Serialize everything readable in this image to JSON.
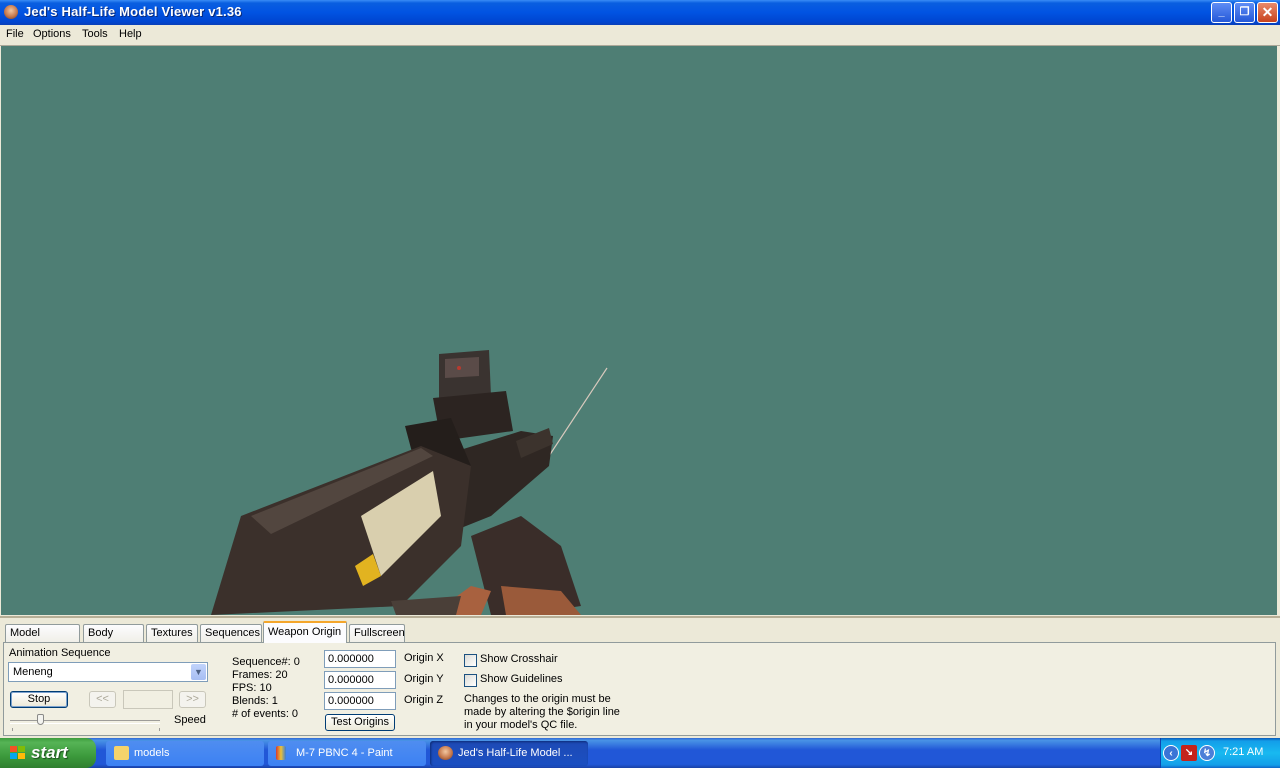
{
  "window": {
    "title": "Jed's Half-Life Model Viewer v1.36",
    "controls": {
      "minimize": "_",
      "restore": "❐",
      "close": "✕"
    }
  },
  "menu": [
    "File",
    "Options",
    "Tools",
    "Help"
  ],
  "viewport": {
    "background_color": "#4e7e74",
    "content": "P90-style SMG model with holographic sight, held in gloved hands; 'PBNC 4' decal"
  },
  "tabs": [
    {
      "label": "Model Display",
      "active": false
    },
    {
      "label": "Body Parts",
      "active": false
    },
    {
      "label": "Textures",
      "active": false
    },
    {
      "label": "Sequences",
      "active": false
    },
    {
      "label": "Weapon Origin",
      "active": true
    },
    {
      "label": "Fullscreen",
      "active": false
    }
  ],
  "animation": {
    "label": "Animation Sequence",
    "selected": "Meneng",
    "stop_label": "Stop",
    "prev_label": "<<",
    "next_label": ">>",
    "speed_label": "Speed",
    "speed_fraction": 0.2
  },
  "info": {
    "sequence": "Sequence#: 0",
    "frames": "Frames: 20",
    "fps": "FPS: 10",
    "blends": "Blends: 1",
    "events": "# of events: 0"
  },
  "origin": {
    "x_value": "0.000000",
    "y_value": "0.000000",
    "z_value": "0.000000",
    "x_label": "Origin X",
    "y_label": "Origin Y",
    "z_label": "Origin Z",
    "test_label": "Test Origins"
  },
  "options": {
    "crosshair_label": "Show Crosshair",
    "crosshair_checked": false,
    "guidelines_label": "Show Guidelines",
    "guidelines_checked": false,
    "note_line1": "Changes to the origin must be",
    "note_line2": "made by altering the $origin line",
    "note_line3": "in your model's QC file."
  },
  "taskbar": {
    "start_label": "start",
    "tasks": [
      {
        "label": "models",
        "icon": "folder-icon",
        "active": false
      },
      {
        "label": "M-7 PBNC 4 - Paint",
        "icon": "paint-icon",
        "active": false
      },
      {
        "label": "Jed's Half-Life Model ...",
        "icon": "hlmv-icon",
        "active": true
      }
    ],
    "clock": "7:21 AM"
  }
}
